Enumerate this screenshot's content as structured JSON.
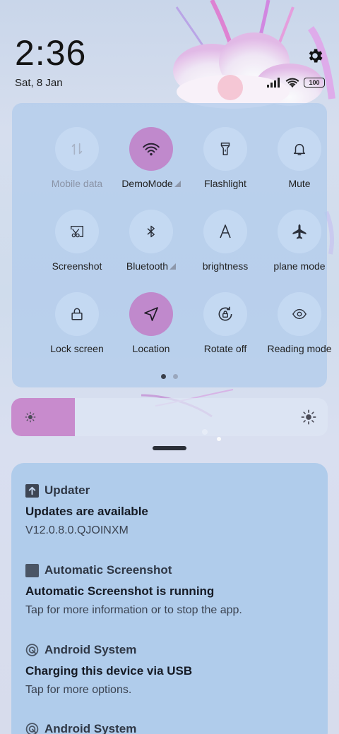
{
  "status_bar": {
    "time": "2:36",
    "date": "Sat, 8 Jan",
    "battery": "100",
    "icons": [
      "signal-icon",
      "wifi-icon",
      "battery-icon"
    ],
    "settings_icon": "gear-icon"
  },
  "quick_settings": {
    "tiles": [
      {
        "label": "Mobile data",
        "icon": "mobile-data-icon",
        "active": false,
        "disabled": true
      },
      {
        "label": "DemoMode",
        "icon": "wifi-icon",
        "active": true,
        "expandable": true
      },
      {
        "label": "Flashlight",
        "icon": "flashlight-icon",
        "active": false
      },
      {
        "label": "Mute",
        "icon": "bell-icon",
        "active": false
      },
      {
        "label": "Screenshot",
        "icon": "screenshot-icon",
        "active": false
      },
      {
        "label": "Bluetooth",
        "icon": "bluetooth-icon",
        "active": false,
        "expandable": true
      },
      {
        "label": "brightness",
        "icon": "auto-brightness-icon",
        "active": false
      },
      {
        "label": "plane mode",
        "icon": "airplane-icon",
        "active": false
      },
      {
        "label": "Lock screen",
        "icon": "lock-icon",
        "active": false
      },
      {
        "label": "Location",
        "icon": "location-icon",
        "active": true
      },
      {
        "label": "Rotate off",
        "icon": "rotate-lock-icon",
        "active": false
      },
      {
        "label": "Reading mode",
        "icon": "eye-icon",
        "active": false
      }
    ],
    "page_count": 2,
    "current_page": 1
  },
  "brightness": {
    "level": 0.2,
    "low_icon": "sun-low-icon",
    "high_icon": "sun-high-icon"
  },
  "notifications": [
    {
      "app": "Updater",
      "icon": "updater-icon",
      "title": "Updates are available",
      "body": "V12.0.8.0.QJOINXM"
    },
    {
      "app": "Automatic Screenshot",
      "icon": "app-square-icon",
      "title": "Automatic Screenshot is running",
      "body": "Tap for more information or to stop the app."
    },
    {
      "app": "Android System",
      "icon": "android-system-icon",
      "title": "Charging this device via USB",
      "body": "Tap for more options."
    },
    {
      "app": "Android System",
      "icon": "android-system-icon",
      "title": "",
      "body": ""
    }
  ],
  "colors": {
    "active_tile": "#c089cc",
    "brightness_fill": "#c88bcd",
    "panel": "#b2ccec"
  }
}
